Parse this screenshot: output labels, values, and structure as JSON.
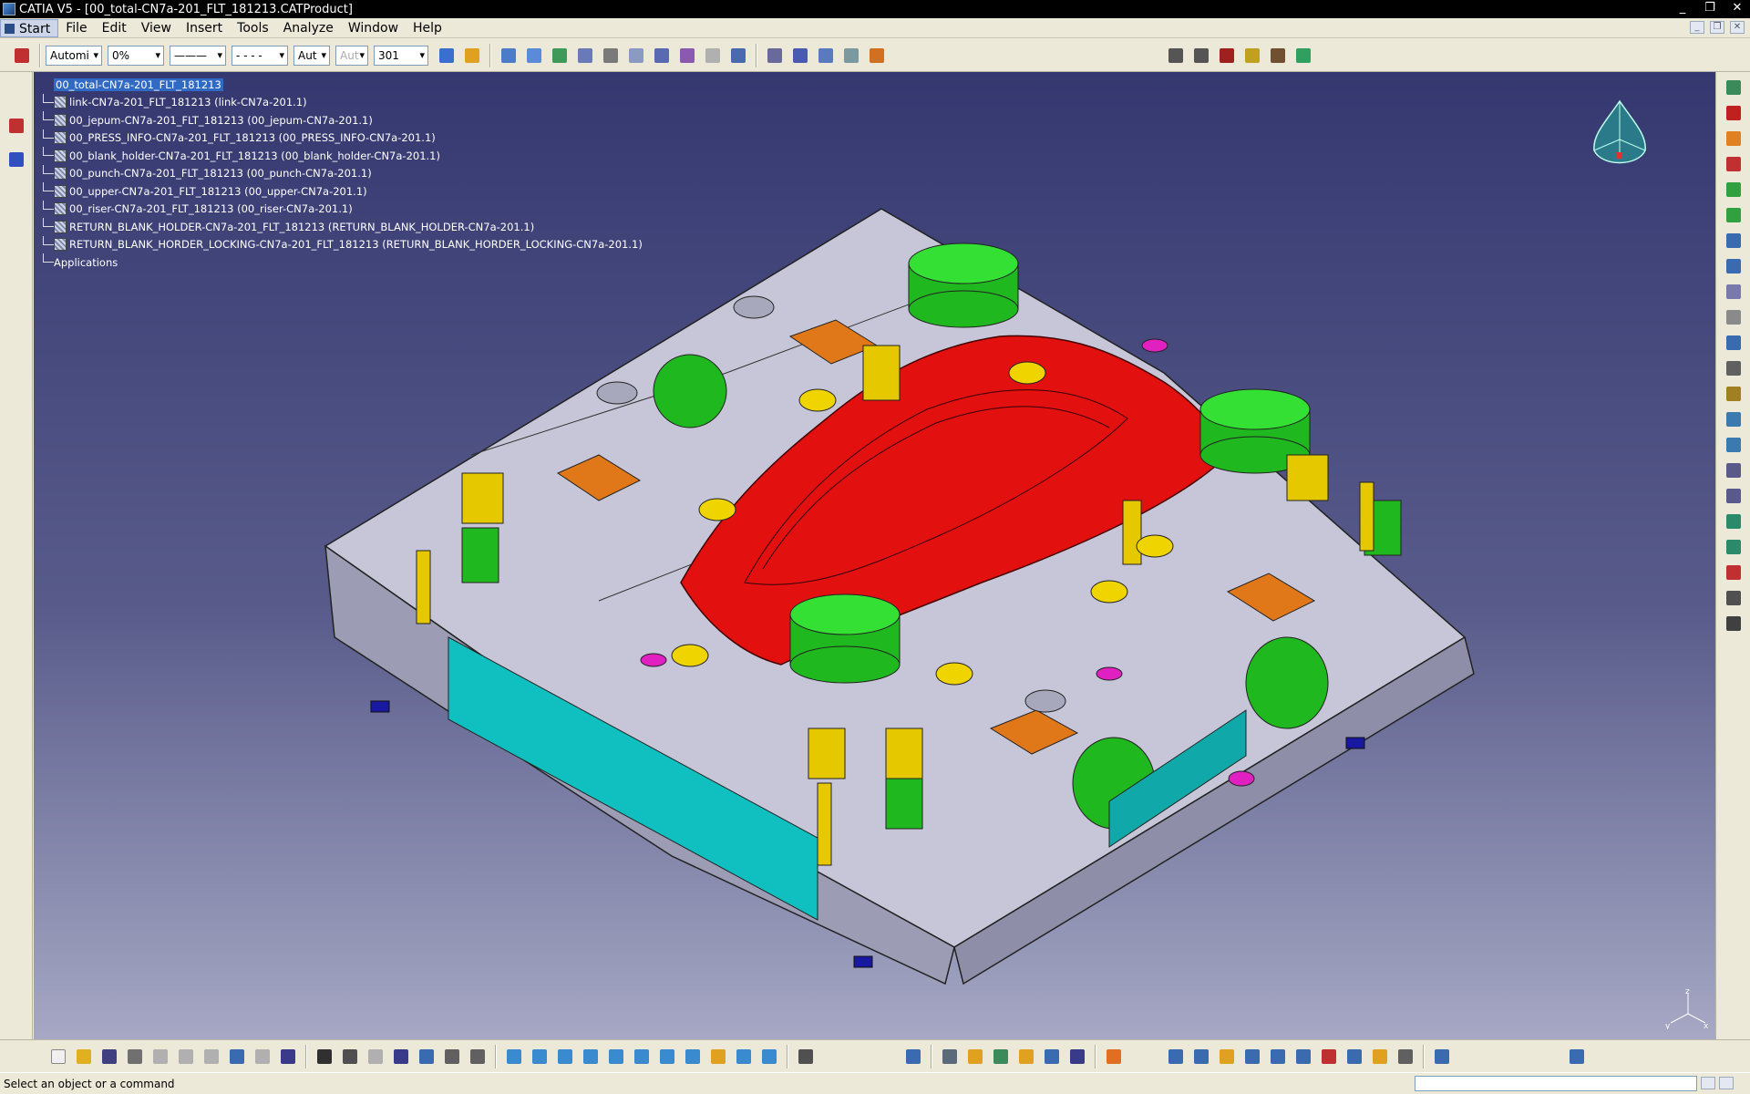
{
  "window": {
    "title": "CATIA V5 - [00_total-CN7a-201_FLT_181213.CATProduct]",
    "controls": [
      "_",
      "❐",
      "✕"
    ],
    "mdi_controls": [
      "_",
      "❐",
      "✕"
    ]
  },
  "menu": {
    "items": [
      "Start",
      "File",
      "Edit",
      "View",
      "Insert",
      "Tools",
      "Analyze",
      "Window",
      "Help"
    ]
  },
  "toolbar": {
    "color_select": "Automi",
    "transparency_select": "0%",
    "linetype_select": "———",
    "lineweight_select": "- - - -",
    "layer_select": "Aut",
    "layer_select2": "Aut",
    "point_select": "301"
  },
  "tree": {
    "root": "00_total-CN7a-201_FLT_181213",
    "children": [
      "link-CN7a-201_FLT_181213 (link-CN7a-201.1)",
      "00_jepum-CN7a-201_FLT_181213 (00_jepum-CN7a-201.1)",
      "00_PRESS_INFO-CN7a-201_FLT_181213 (00_PRESS_INFO-CN7a-201.1)",
      "00_blank_holder-CN7a-201_FLT_181213 (00_blank_holder-CN7a-201.1)",
      "00_punch-CN7a-201_FLT_181213 (00_punch-CN7a-201.1)",
      "00_upper-CN7a-201_FLT_181213 (00_upper-CN7a-201.1)",
      "00_riser-CN7a-201_FLT_181213 (00_riser-CN7a-201.1)",
      "RETURN_BLANK_HOLDER-CN7a-201_FLT_181213 (RETURN_BLANK_HOLDER-CN7a-201.1)",
      "RETURN_BLANK_HORDER_LOCKING-CN7a-201_FLT_181213 (RETURN_BLANK_HORDER_LOCKING-CN7a-201.1)"
    ],
    "applications": "Applications"
  },
  "viewport": {
    "axis_labels": [
      "z",
      "y",
      "x"
    ],
    "colors": {
      "background_top": "#353870",
      "background_bottom": "#a6a8c4",
      "die_body": "#c6c6d8",
      "punch": "#e31010",
      "cylinders": "#22d822",
      "plates": "#e0781a",
      "guides": "#e6c800",
      "panels": "#10c0c0"
    }
  },
  "status": {
    "message": "Select an object or a command"
  },
  "icons": {
    "top_left": [
      "product-icon"
    ],
    "top_tools": [
      "paint-icon",
      "fill-icon",
      "wrench-icon",
      "cube-icon",
      "gear-icon",
      "layer-icon",
      "pencil-icon",
      "filter-icon",
      "link-icon",
      "bolt-icon",
      "grid-icon",
      "measure-icon",
      "abc-icon",
      "lasso-icon",
      "bucket-icon",
      "swatch-icon"
    ],
    "top_right": [
      "bom-icon",
      "bom2-icon",
      "bolt-report-icon",
      "save-icon",
      "book-icon",
      "tree-icon"
    ],
    "bottom": [
      "new-icon",
      "open-icon",
      "save-icon",
      "print-icon",
      "cut-icon",
      "copy-icon",
      "paste-icon",
      "undo-icon",
      "redo-icon",
      "whats-this-icon",
      "formula-icon",
      "comment-icon",
      "fly-icon",
      "table-icon",
      "tree-icon",
      "lock-icon",
      "hand-icon",
      "fit-all-icon",
      "pan-icon",
      "rotate-icon",
      "zoom-in-icon",
      "zoom-out-icon",
      "normal-view-icon",
      "iso-view-icon",
      "render-icon",
      "hide-icon",
      "swap-icon",
      "sheet-icon",
      "align-icon",
      "generate-icon",
      "cog-icon",
      "drill-icon",
      "wave-icon",
      "net-icon",
      "pcs-icon"
    ]
  }
}
